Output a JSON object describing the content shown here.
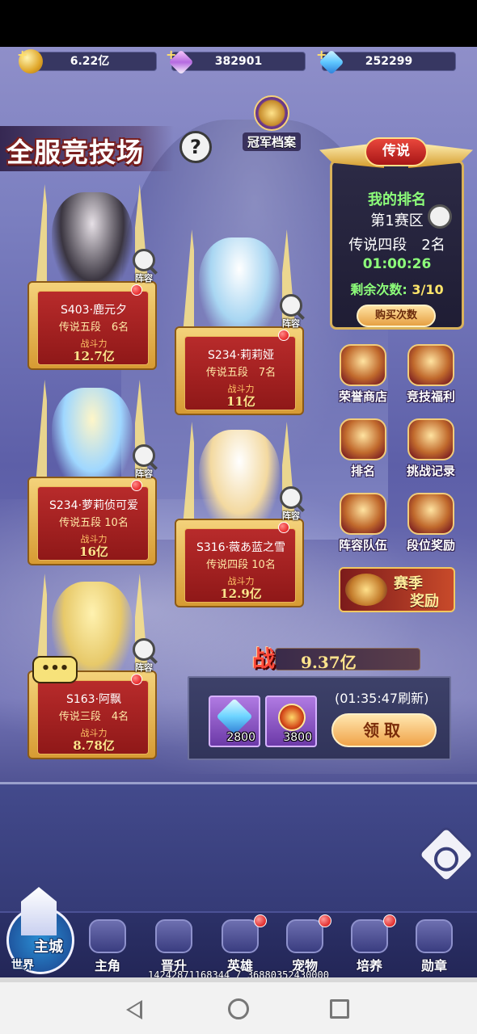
{
  "currencies": [
    {
      "icon": "gold-coin-icon",
      "value": "6.22亿"
    },
    {
      "icon": "purple-diamond-icon",
      "value": "382901"
    },
    {
      "icon": "blue-diamond-icon",
      "value": "252299"
    }
  ],
  "header": {
    "title": "全服竞技场",
    "help": "?",
    "champion_archive": "冠军档案"
  },
  "opponents": [
    {
      "name": "S403·鹿元夕",
      "rank": "传说五段　6名",
      "power_label": "战斗力",
      "power": "12.7亿",
      "lineup": "阵容"
    },
    {
      "name": "S234·莉莉娅",
      "rank": "传说五段　7名",
      "power_label": "战斗力",
      "power": "11亿",
      "lineup": "阵容"
    },
    {
      "name": "S234·萝莉侦可爱",
      "rank": "传说五段 10名",
      "power_label": "战斗力",
      "power": "16亿",
      "lineup": "阵容"
    },
    {
      "name": "S316·薇あ蓝之雪",
      "rank": "传说四段 10名",
      "power_label": "战斗力",
      "power": "12.9亿",
      "lineup": "阵容"
    },
    {
      "name": "S163·阿飘",
      "rank": "传说三段　4名",
      "power_label": "战斗力",
      "power": "8.78亿",
      "lineup": "阵容"
    }
  ],
  "rank_panel": {
    "badge": "传说",
    "title": "我的排名",
    "zone": "第1赛区",
    "tier": "传说四段　2名",
    "timer": "01:00:26",
    "remaining_label": "剩余次数:",
    "remaining_value": "3/10",
    "buy_button": "购买次数"
  },
  "right_menu": [
    {
      "icon": "honor-shop-icon",
      "label": "荣誉商店"
    },
    {
      "icon": "arena-benefit-icon",
      "label": "竞技福利"
    },
    {
      "icon": "trophy-icon",
      "label": "排名"
    },
    {
      "icon": "battle-record-icon",
      "label": "挑战记录"
    },
    {
      "icon": "lineup-team-icon",
      "label": "阵容队伍"
    },
    {
      "icon": "tier-reward-icon",
      "label": "段位奖励"
    }
  ],
  "season_reward": {
    "line1": "赛季",
    "line2": "奖励"
  },
  "my_power": {
    "label": "战",
    "value": "9.37亿"
  },
  "reward": {
    "items": [
      {
        "icon": "blue-diamond-icon",
        "qty": "2800"
      },
      {
        "icon": "honor-medal-icon",
        "qty": "3800"
      }
    ],
    "refresh": "(01:35:47刷新)",
    "claim": "领取"
  },
  "chat_bubble": "•••",
  "bottom_nav": [
    {
      "label": "主角",
      "badge": false
    },
    {
      "label": "晋升",
      "badge": false
    },
    {
      "label": "英雄",
      "badge": true
    },
    {
      "label": "宠物",
      "badge": true
    },
    {
      "label": "培养",
      "badge": true
    },
    {
      "label": "勋章",
      "badge": false
    }
  ],
  "city": {
    "main": "主城",
    "world": "世界"
  },
  "debug_text": "14242871168344 / 36880352430000"
}
